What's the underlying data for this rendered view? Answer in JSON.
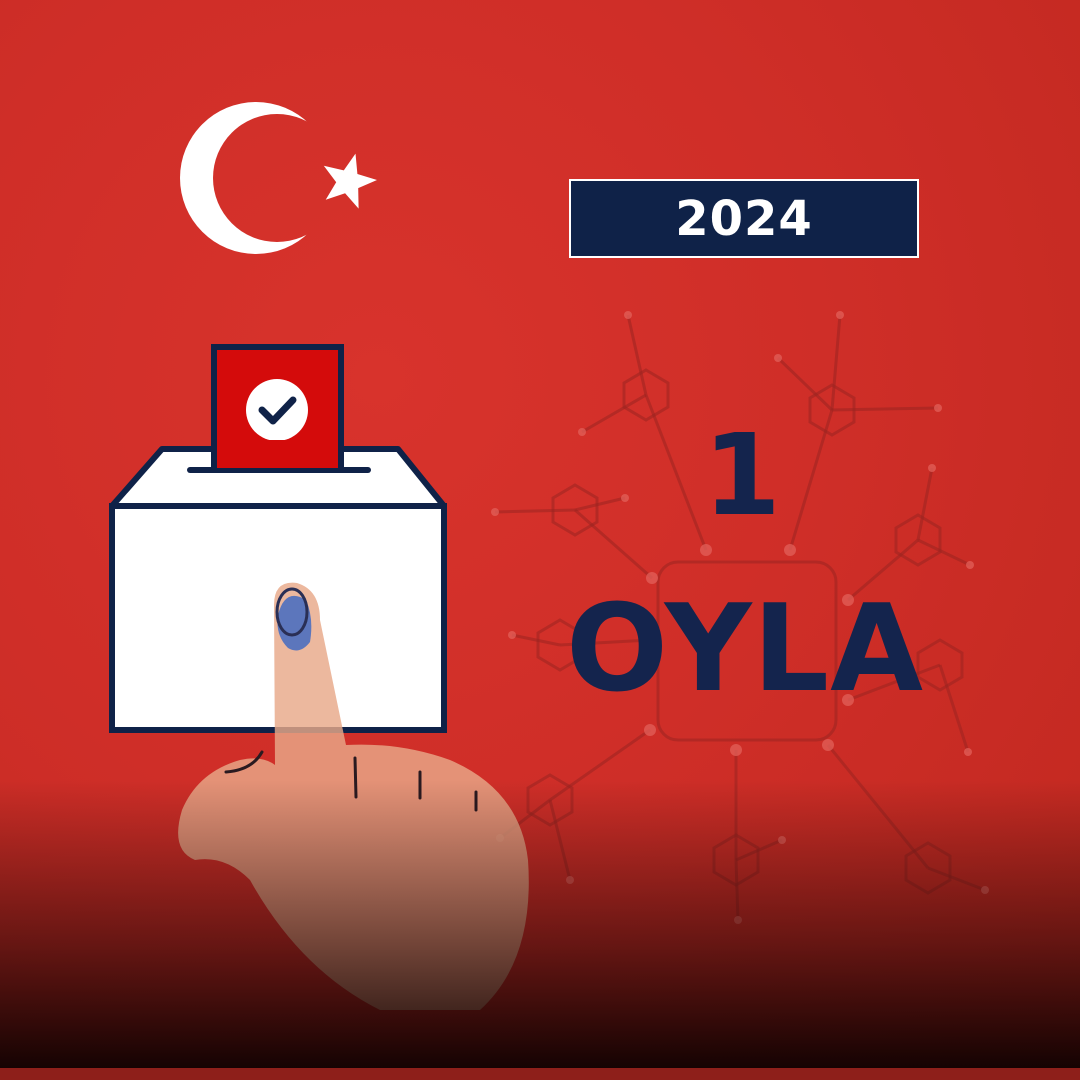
{
  "year": {
    "label": "2024"
  },
  "headline": {
    "number": "1",
    "word": "OYLA"
  },
  "colors": {
    "background": "#cf2e28",
    "navy": "#0f2248",
    "white": "#ffffff"
  },
  "icons": [
    "crescent-star-icon",
    "molecule-network-icon",
    "ballot-box-icon",
    "checkmark-icon",
    "pointing-hand-icon"
  ]
}
